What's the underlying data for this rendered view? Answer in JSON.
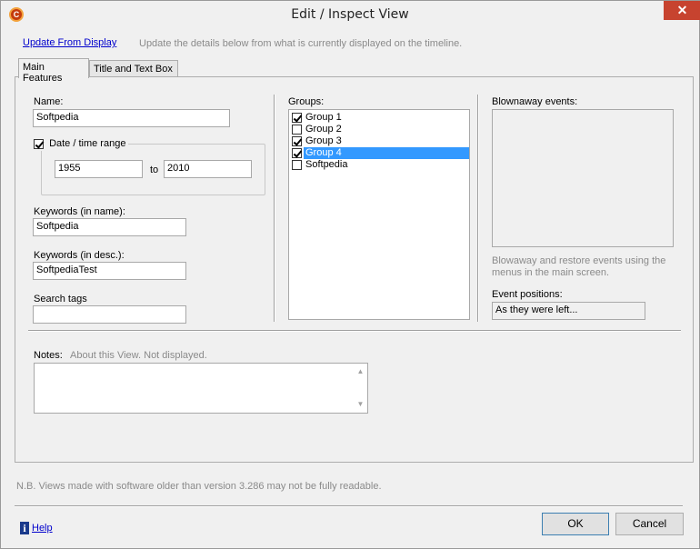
{
  "window": {
    "title": "Edit / Inspect View",
    "close_glyph": "✕",
    "app_icon_glyph": "C"
  },
  "header": {
    "update_link": "Update From Display",
    "update_hint": "Update the details below from what is currently displayed on the timeline."
  },
  "tabs": [
    {
      "label": "Main Features",
      "active": true
    },
    {
      "label": "Title and Text Box",
      "active": false
    }
  ],
  "main": {
    "name_label": "Name:",
    "name_value": "Softpedia",
    "date_range": {
      "label": "Date / time range",
      "checked": true,
      "from": "1955",
      "to_label": "to",
      "to": "2010"
    },
    "keywords_name_label": "Keywords (in name):",
    "keywords_name_value": "Softpedia",
    "keywords_desc_label": "Keywords (in desc.):",
    "keywords_desc_value": "SoftpediaTest",
    "search_tags_label": "Search tags",
    "search_tags_value": ""
  },
  "groups": {
    "label": "Groups:",
    "items": [
      {
        "label": "Group 1",
        "checked": true,
        "selected": false
      },
      {
        "label": "Group 2",
        "checked": false,
        "selected": false
      },
      {
        "label": "Group 3",
        "checked": true,
        "selected": false
      },
      {
        "label": "Group 4",
        "checked": true,
        "selected": true
      },
      {
        "label": "Softpedia",
        "checked": false,
        "selected": false
      }
    ]
  },
  "blownaway": {
    "label": "Blownaway events:",
    "hint": "Blowaway and restore events using the menus in the main screen.",
    "positions_label": "Event positions:",
    "positions_value": "As they were left..."
  },
  "notes": {
    "label": "Notes:",
    "hint": "About this View. Not displayed.",
    "value": ""
  },
  "footer": {
    "note": "N.B. Views made with software older than version 3.286 may not be fully readable.",
    "help_label": "Help",
    "help_glyph": "i",
    "ok_label": "OK",
    "cancel_label": "Cancel"
  },
  "colors": {
    "selection": "#3399ff",
    "link": "#0000cc",
    "close_button": "#c7432f"
  }
}
